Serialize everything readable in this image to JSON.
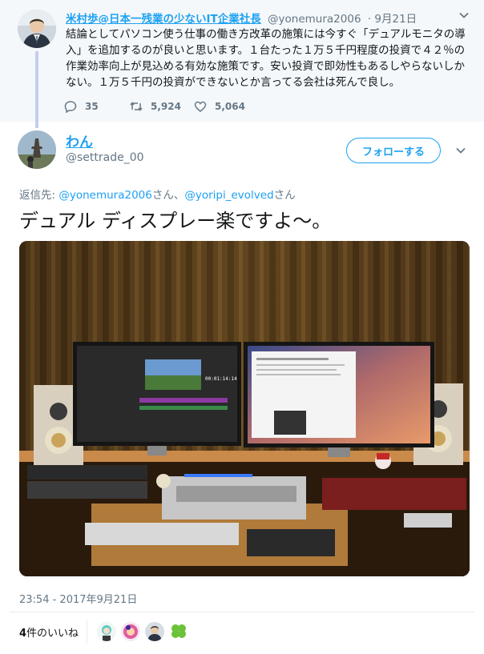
{
  "parent_tweet": {
    "display_name": "米村歩@日本一残業の少ないIT企業社長",
    "handle": "@yonemura2006",
    "date": "· 9月21日",
    "text": "結論としてパソコン使う仕事の働き方改革の施策には今すぐ「デュアルモニタの導入」を追加するのが良いと思います。１台たった１万５千円程度の投資で４２％の作業効率向上が見込める有効な施策です。安い投資で即効性もあるしやらないしかない。１万５千円の投資ができないとか言ってる会社は死んで良し。",
    "replies": "35",
    "retweets": "5,924",
    "likes": "5,064",
    "icons": [
      "reply-icon",
      "retweet-icon",
      "like-icon",
      "chevron-down-icon"
    ]
  },
  "main_tweet": {
    "display_name": "わん",
    "handle": "@settrade_00",
    "follow_label": "フォローする",
    "reply_prefix": "返信先: ",
    "reply_user1": "@yonemura2006",
    "reply_mid": "さん、",
    "reply_user2": "@yoripi_evolved",
    "reply_suffix": "さん",
    "text": "デュアル ディスプレー楽ですよ〜。",
    "screen_time": "00:01:14:14",
    "timestamp": "23:54 - 2017年9月21日",
    "likes_count": "4",
    "likes_label": "件のいいね"
  },
  "colors": {
    "accent": "#1da1f2",
    "muted": "#657786",
    "thread_line": "#c4cdf0",
    "parent_bg": "#f5f8fa"
  }
}
